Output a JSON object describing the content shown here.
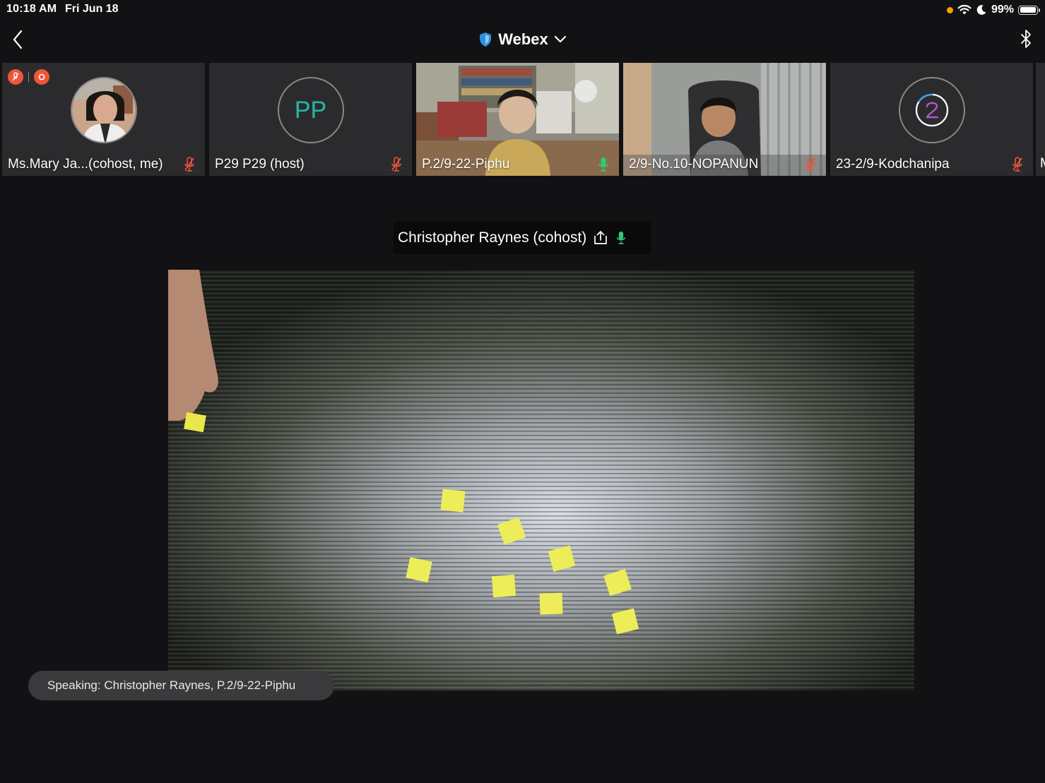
{
  "status_bar": {
    "time": "10:18 AM",
    "date": "Fri Jun 18",
    "battery_percent_label": "99%",
    "battery_level": 0.99,
    "icons": [
      "mic-in-use-dot-icon",
      "wifi-icon",
      "moon-icon",
      "battery-icon"
    ]
  },
  "nav": {
    "back_icon": "chevron-left-icon",
    "title": "Webex",
    "title_icon": "shield-icon",
    "title_dropdown_icon": "chevron-down-icon",
    "right_icon": "bluetooth-icon"
  },
  "participants": [
    {
      "name": "Ms.Mary Ja...(cohost, me)",
      "avatar": "photo",
      "mic": "muted",
      "badges": [
        "muted-mic-badge-icon",
        "recording-badge-icon"
      ]
    },
    {
      "name": "P29 P29 (host)",
      "avatar": "initials",
      "initials": "PP",
      "mic": "muted"
    },
    {
      "name": "P.2/9-22-Piphu",
      "avatar": "video",
      "mic": "active"
    },
    {
      "name": "2/9-No.10-NOPANUN",
      "avatar": "video",
      "mic": "muted"
    },
    {
      "name": "23-2/9-Kodchanipa",
      "avatar": "loading",
      "mic": "muted"
    }
  ],
  "peek_participant_initial": "M",
  "active_speaker": {
    "label": "Christopher Raynes (cohost)",
    "share_icon": "share-screen-icon",
    "mic": "active"
  },
  "speaking_toast": "Speaking: Christopher Raynes, P.2/9-22-Piphu",
  "colors": {
    "background": "#121214",
    "tile": "#2b2b2d",
    "muted_mic": "#f0553a",
    "active_mic": "#2ecc71",
    "initials": "#27b6a8",
    "webex_shield": "#2e8fe0"
  }
}
